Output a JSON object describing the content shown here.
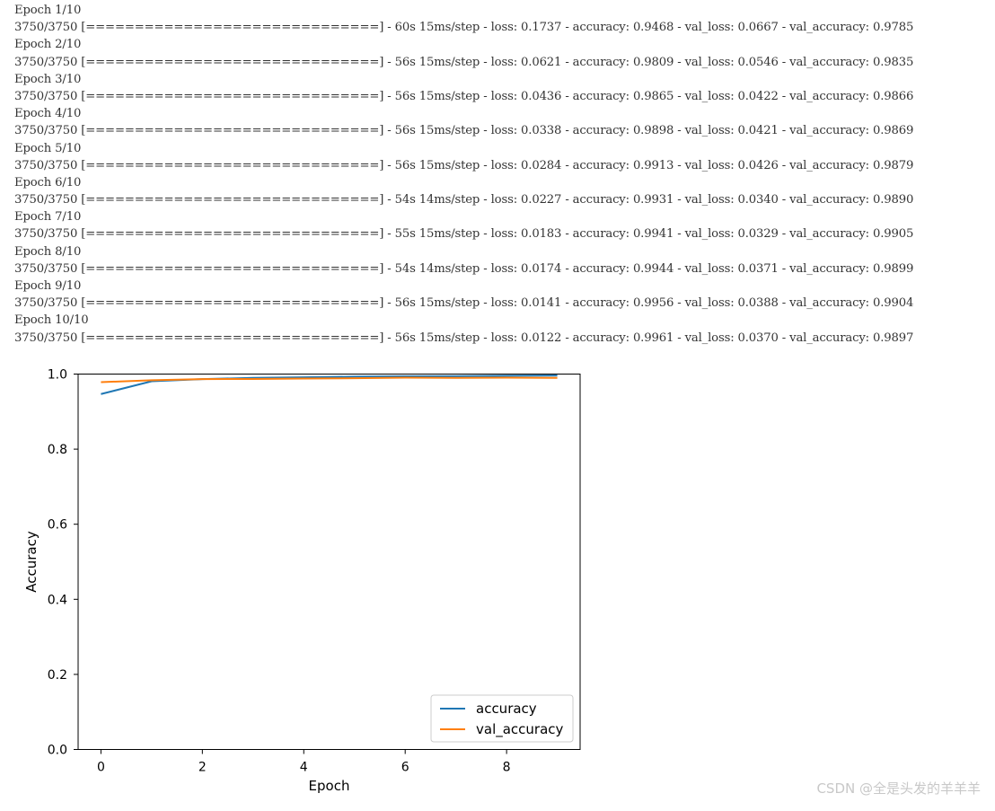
{
  "training_log": [
    "Epoch 1/10",
    "3750/3750 [==============================] - 60s 15ms/step - loss: 0.1737 - accuracy: 0.9468 - val_loss: 0.0667 - val_accuracy: 0.9785",
    "Epoch 2/10",
    "3750/3750 [==============================] - 56s 15ms/step - loss: 0.0621 - accuracy: 0.9809 - val_loss: 0.0546 - val_accuracy: 0.9835",
    "Epoch 3/10",
    "3750/3750 [==============================] - 56s 15ms/step - loss: 0.0436 - accuracy: 0.9865 - val_loss: 0.0422 - val_accuracy: 0.9866",
    "Epoch 4/10",
    "3750/3750 [==============================] - 56s 15ms/step - loss: 0.0338 - accuracy: 0.9898 - val_loss: 0.0421 - val_accuracy: 0.9869",
    "Epoch 5/10",
    "3750/3750 [==============================] - 56s 15ms/step - loss: 0.0284 - accuracy: 0.9913 - val_loss: 0.0426 - val_accuracy: 0.9879",
    "Epoch 6/10",
    "3750/3750 [==============================] - 54s 14ms/step - loss: 0.0227 - accuracy: 0.9931 - val_loss: 0.0340 - val_accuracy: 0.9890",
    "Epoch 7/10",
    "3750/3750 [==============================] - 55s 15ms/step - loss: 0.0183 - accuracy: 0.9941 - val_loss: 0.0329 - val_accuracy: 0.9905",
    "Epoch 8/10",
    "3750/3750 [==============================] - 54s 14ms/step - loss: 0.0174 - accuracy: 0.9944 - val_loss: 0.0371 - val_accuracy: 0.9899",
    "Epoch 9/10",
    "3750/3750 [==============================] - 56s 15ms/step - loss: 0.0141 - accuracy: 0.9956 - val_loss: 0.0388 - val_accuracy: 0.9904",
    "Epoch 10/10",
    "3750/3750 [==============================] - 56s 15ms/step - loss: 0.0122 - accuracy: 0.9961 - val_loss: 0.0370 - val_accuracy: 0.9897"
  ],
  "chart_data": {
    "type": "line",
    "title": "",
    "xlabel": "Epoch",
    "ylabel": "Accuracy",
    "x": [
      0,
      1,
      2,
      3,
      4,
      5,
      6,
      7,
      8,
      9
    ],
    "xlim": [
      -0.45,
      9.45
    ],
    "ylim": [
      0.0,
      1.0
    ],
    "xticks": [
      0,
      2,
      4,
      6,
      8
    ],
    "yticks": [
      0.0,
      0.2,
      0.4,
      0.6,
      0.8,
      1.0
    ],
    "xtick_labels": [
      "0",
      "2",
      "4",
      "6",
      "8"
    ],
    "ytick_labels": [
      "0.0",
      "0.2",
      "0.4",
      "0.6",
      "0.8",
      "1.0"
    ],
    "grid": false,
    "legend_position": "lower-right",
    "series": [
      {
        "name": "accuracy",
        "color": "#1f77b4",
        "values": [
          0.9468,
          0.9809,
          0.9865,
          0.9898,
          0.9913,
          0.9931,
          0.9941,
          0.9944,
          0.9956,
          0.9961
        ]
      },
      {
        "name": "val_accuracy",
        "color": "#ff7f0e",
        "values": [
          0.9785,
          0.9835,
          0.9866,
          0.9869,
          0.9879,
          0.989,
          0.9905,
          0.9899,
          0.9904,
          0.9897
        ]
      }
    ]
  },
  "watermark": "CSDN @全是头发的羊羊羊"
}
